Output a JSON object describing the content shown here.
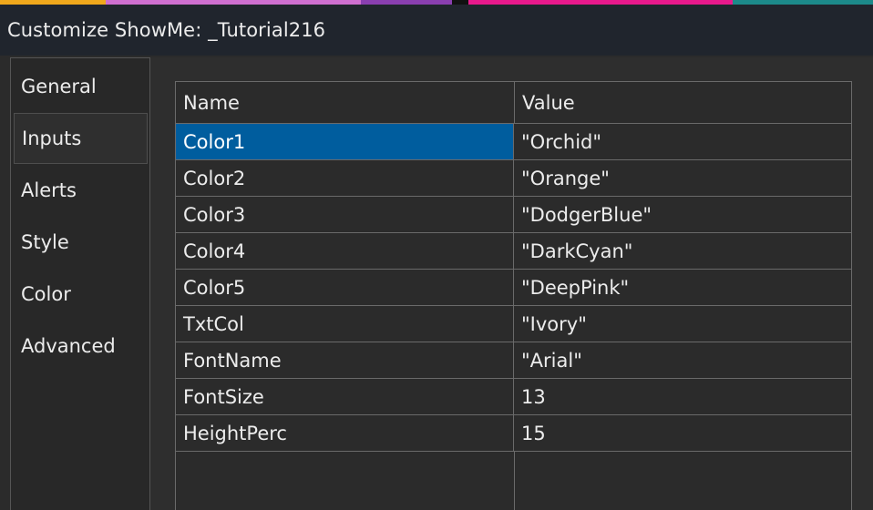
{
  "window": {
    "title": "Customize ShowMe: _Tutorial216"
  },
  "colors": {
    "title_bar_bg": "#20252d",
    "selection_bg": "#005d9e",
    "grid_line": "#6a6a6a"
  },
  "sidebar": {
    "items": [
      {
        "label": "General",
        "active": false
      },
      {
        "label": "Inputs",
        "active": true
      },
      {
        "label": "Alerts",
        "active": false
      },
      {
        "label": "Style",
        "active": false
      },
      {
        "label": "Color",
        "active": false
      },
      {
        "label": "Advanced",
        "active": false
      }
    ]
  },
  "grid": {
    "columns": [
      "Name",
      "Value"
    ],
    "rows": [
      {
        "name": "Color1",
        "value": "\"Orchid\"",
        "selected": true
      },
      {
        "name": "Color2",
        "value": "\"Orange\"",
        "selected": false
      },
      {
        "name": "Color3",
        "value": "\"DodgerBlue\"",
        "selected": false
      },
      {
        "name": "Color4",
        "value": "\"DarkCyan\"",
        "selected": false
      },
      {
        "name": "Color5",
        "value": "\"DeepPink\"",
        "selected": false
      },
      {
        "name": "TxtCol",
        "value": "\"Ivory\"",
        "selected": false
      },
      {
        "name": "FontName",
        "value": "\"Arial\"",
        "selected": false
      },
      {
        "name": "FontSize",
        "value": "13",
        "selected": false
      },
      {
        "name": "HeightPerc",
        "value": "15",
        "selected": false
      }
    ]
  }
}
